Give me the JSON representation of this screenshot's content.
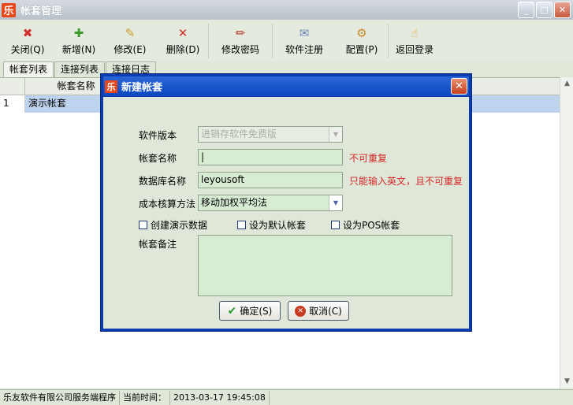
{
  "window": {
    "app_icon": "乐",
    "title": "帐套管理",
    "minimize": "_",
    "maximize": "□",
    "close": "✕"
  },
  "toolbar": [
    {
      "icon": "close-circle-icon",
      "glyph": "✖",
      "color": "#d22e2e",
      "label": "关闭(Q)"
    },
    {
      "icon": "add-icon",
      "glyph": "✚",
      "color": "#3a9a2a",
      "label": "新增(N)"
    },
    {
      "icon": "edit-icon",
      "glyph": "✎",
      "color": "#c99a2e",
      "label": "修改(E)"
    },
    {
      "icon": "delete-x-icon",
      "glyph": "✕",
      "color": "#d22e2e",
      "label": "删除(D)"
    },
    {
      "icon": "pen-icon",
      "glyph": "✏",
      "color": "#b83a2a",
      "label": "修改密码"
    },
    {
      "icon": "envelope-icon",
      "glyph": "✉",
      "color": "#6a88b5",
      "label": "软件注册"
    },
    {
      "icon": "gear-icon",
      "glyph": "⚙",
      "color": "#c88a2a",
      "label": "配置(P)"
    },
    {
      "icon": "back-login-icon",
      "glyph": "☝",
      "color": "#e0a82a",
      "label": "返回登录"
    }
  ],
  "tabs": [
    "帐套列表",
    "连接列表",
    "连接日志"
  ],
  "grid": {
    "header": [
      "帐套名称"
    ],
    "rows": [
      {
        "num": "1",
        "name": "演示帐套"
      }
    ]
  },
  "statusbar": {
    "company": "乐友软件有限公司服务端程序",
    "time_label": "当前时间：",
    "time_value": "2013-03-17  19:45:08"
  },
  "dialog": {
    "icon": "乐",
    "title": "新建帐套",
    "close": "✕",
    "version_label": "软件版本",
    "version_value": "进销存软件免费版",
    "name_label": "帐套名称",
    "name_value": "|",
    "name_hint": "不可重复",
    "db_label": "数据库名称",
    "db_value": "leyousoft",
    "db_hint": "只能输入英文，且不可重复",
    "cost_label": "成本核算方法",
    "cost_value": "移动加权平均法",
    "chk_demo": "创建演示数据",
    "chk_default": "设为默认帐套",
    "chk_pos": "设为POS帐套",
    "note_label": "帐套备注",
    "ok": "确定(S)",
    "cancel": "取消(C)"
  }
}
